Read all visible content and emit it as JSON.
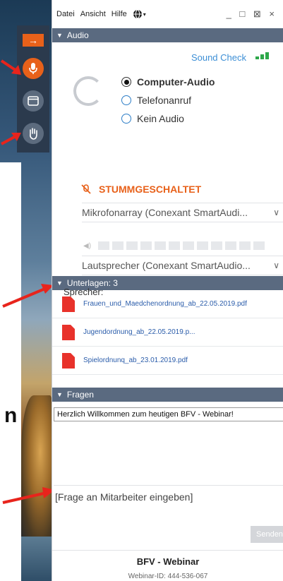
{
  "menu": {
    "items": [
      "Datei",
      "Ansicht",
      "Hilfe"
    ],
    "window_controls": "_ □ ⊠ ×"
  },
  "audio": {
    "title": "Audio",
    "sound_check": "Sound Check",
    "options": [
      "Computer-Audio",
      "Telefonanruf",
      "Kein Audio"
    ],
    "selected": "Computer-Audio",
    "muted_label": "STUMMGESCHALTET",
    "microphone": "Mikrofonarray (Conexant SmartAudi...",
    "speaker": "Lautsprecher (Conexant SmartAudio...",
    "speaker_label": "Sprecher:"
  },
  "documents": {
    "title": "Unterlagen: 3",
    "files": [
      "Frauen_und_Maedchenordnung_ab_22.05.2019.pdf",
      "Jugendordnung_ab_22.05.2019.p...",
      "Spielordnunq_ab_23.01.2019.pdf"
    ]
  },
  "questions": {
    "title": "Fragen",
    "welcome": "Herzlich Willkommen zum heutigen BFV - Webinar!",
    "placeholder": "[Frage an Mitarbeiter eingeben]",
    "send_label": "Senden"
  },
  "footer": {
    "webinar_name": "BFV - Webinar",
    "webinar_id": "Webinar-ID: 444-536-067"
  },
  "background": {
    "partial_letter": "n"
  },
  "colors": {
    "accent": "#e8611a",
    "header": "#5a6a80",
    "toolbar": "#2b3a4d",
    "link": "#3d8fd6",
    "pdf": "#e8322b",
    "arrow": "#e8241c"
  }
}
